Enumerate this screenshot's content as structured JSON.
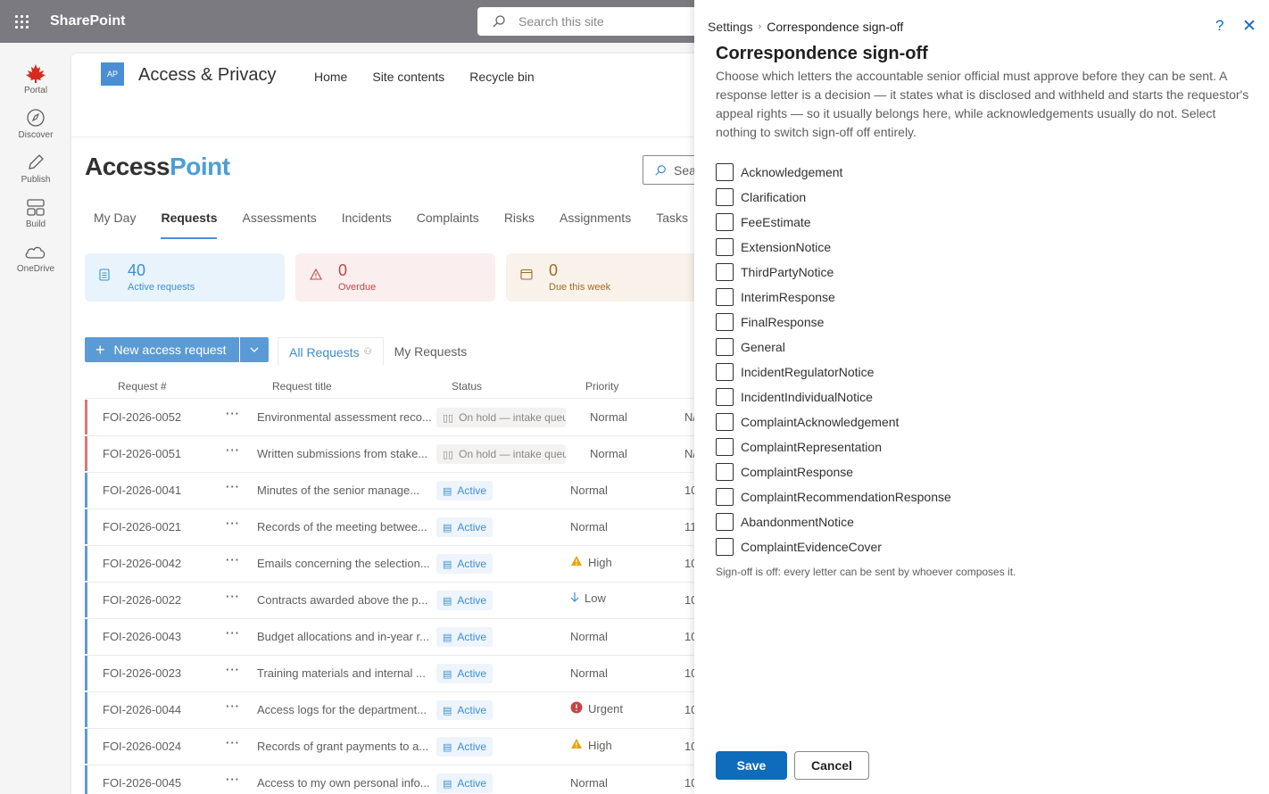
{
  "suite": {
    "app_name": "SharePoint",
    "search_placeholder": "Search this site"
  },
  "appbar": [
    {
      "label": "Portal",
      "icon": "maple-leaf-icon"
    },
    {
      "label": "Discover",
      "icon": "compass-icon"
    },
    {
      "label": "Publish",
      "icon": "pen-icon"
    },
    {
      "label": "Build",
      "icon": "layout-icon"
    },
    {
      "label": "OneDrive",
      "icon": "cloud-icon"
    }
  ],
  "site": {
    "logo_text": "AP",
    "title": "Access & Privacy",
    "nav": [
      "Home",
      "Site contents",
      "Recycle bin"
    ]
  },
  "brand": {
    "part1": "Access",
    "part2": "Point"
  },
  "main_search": {
    "placeholder": "Sea"
  },
  "tabs": [
    "My Day",
    "Requests",
    "Assessments",
    "Incidents",
    "Complaints",
    "Risks",
    "Assignments",
    "Tasks"
  ],
  "active_tab": "Requests",
  "cards": [
    {
      "value": "40",
      "label": "Active requests"
    },
    {
      "value": "0",
      "label": "Overdue"
    },
    {
      "value": "0",
      "label": "Due this week"
    }
  ],
  "commands": {
    "new_request": "New access request"
  },
  "views": [
    "All Requests",
    "My Requests"
  ],
  "table": {
    "headers": [
      "Request #",
      "Request title",
      "Status",
      "Priority"
    ],
    "rows": [
      {
        "id": "FOI-2026-0052",
        "title": "Environmental assessment reco...",
        "status": "On hold — intake queue",
        "priority": "Normal",
        "trail": "N/",
        "kind": "hold"
      },
      {
        "id": "FOI-2026-0051",
        "title": "Written submissions from stake...",
        "status": "On hold — intake queue",
        "priority": "Normal",
        "trail": "N/",
        "kind": "hold"
      },
      {
        "id": "FOI-2026-0041",
        "title": "Minutes of the senior manage...",
        "status": "Active",
        "priority": "Normal",
        "trail": "10",
        "kind": "active"
      },
      {
        "id": "FOI-2026-0021",
        "title": "Records of the meeting betwee...",
        "status": "Active",
        "priority": "Normal",
        "trail": "11",
        "kind": "active"
      },
      {
        "id": "FOI-2026-0042",
        "title": "Emails concerning the selection...",
        "status": "Active",
        "priority": "High",
        "trail": "10",
        "kind": "active"
      },
      {
        "id": "FOI-2026-0022",
        "title": "Contracts awarded above the p...",
        "status": "Active",
        "priority": "Low",
        "trail": "10",
        "kind": "active"
      },
      {
        "id": "FOI-2026-0043",
        "title": "Budget allocations and in-year r...",
        "status": "Active",
        "priority": "Normal",
        "trail": "10",
        "kind": "active"
      },
      {
        "id": "FOI-2026-0023",
        "title": "Training materials and internal ...",
        "status": "Active",
        "priority": "Normal",
        "trail": "10",
        "kind": "active"
      },
      {
        "id": "FOI-2026-0044",
        "title": "Access logs for the department...",
        "status": "Active",
        "priority": "Urgent",
        "trail": "10",
        "kind": "active"
      },
      {
        "id": "FOI-2026-0024",
        "title": "Records of grant payments to a...",
        "status": "Active",
        "priority": "High",
        "trail": "10",
        "kind": "active"
      },
      {
        "id": "FOI-2026-0045",
        "title": "Access to my own personal info...",
        "status": "Active",
        "priority": "Normal",
        "trail": "10",
        "kind": "active"
      }
    ]
  },
  "panel": {
    "breadcrumb_root": "Settings",
    "breadcrumb_current": "Correspondence sign-off",
    "title": "Correspondence sign-off",
    "description": "Choose which letters the accountable senior official must approve before they can be sent. A response letter is a decision — it states what is disclosed and withheld and starts the requestor's appeal rights — so it usually belongs here, while acknowledgements usually do not. Select nothing to switch sign-off off entirely.",
    "options": [
      "Acknowledgement",
      "Clarification",
      "FeeEstimate",
      "ExtensionNotice",
      "ThirdPartyNotice",
      "InterimResponse",
      "FinalResponse",
      "General",
      "IncidentRegulatorNotice",
      "IncidentIndividualNotice",
      "ComplaintAcknowledgement",
      "ComplaintRepresentation",
      "ComplaintResponse",
      "ComplaintRecommendationResponse",
      "AbandonmentNotice",
      "ComplaintEvidenceCover"
    ],
    "note": "Sign-off is off: every letter can be sent by whoever composes it.",
    "save_label": "Save",
    "cancel_label": "Cancel"
  },
  "colors": {
    "accent": "#0f6cbd",
    "brand_blue": "#4a9fd6",
    "suitebar": "#7a7a80",
    "hold_bar": "#d9777a",
    "active_bar": "#5b9bd5"
  }
}
